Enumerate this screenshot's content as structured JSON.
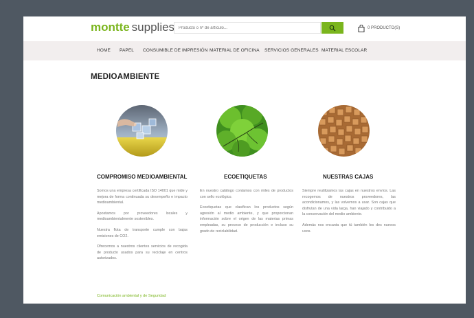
{
  "header": {
    "logo_bold": "montte",
    "logo_light": "supplies",
    "search_placeholder": "Producto o nº de artículo...",
    "cart_label": "0 PRODUCTO(S)"
  },
  "nav": {
    "items": [
      "HOME",
      "PAPEL",
      "CONSUMIBLE DE IMPRESIÓN",
      "MATERIAL DE OFICINA",
      "SERVICIOS GENERALES",
      "MATERIAL ESCOLAR"
    ]
  },
  "main": {
    "title": "MEDIOAMBIENTE",
    "columns": [
      {
        "title": "COMPROMISO MEDIOAMBIENTAL",
        "paragraphs": [
          "Somos una empresa certificada ISO 14001 que mide y mejora de forma continuada su desempeño e impacto medioambiental.",
          "Apostamos por proveedores locales y medioambientalmente sostenibles.",
          "Nuestra flota de transporte cumple con bajas emisiones de CO2.",
          "Ofrecemos a nuestros clientes servicios de recogida de producto usados para su reciclaje en centros autorizados."
        ],
        "link": "Comunicación ambiental y de Seguridad"
      },
      {
        "title": "ECOETIQUETAS",
        "paragraphs": [
          "En nuestro catálogo contamos con miles de productos con sello ecológico.",
          "Ecoetiquetas que clasifican los productos según agresión al medio ambiente, y que proporcionan información sobre el origen de las materias primas empleadas, su proceso de producción e incluso su grado de reciclabilidad."
        ]
      },
      {
        "title": "NUESTRAS CAJAS",
        "paragraphs": [
          "Siempre reutilizamos las cajas en nuestros envíos. Las recogemos de nuestros proveedores, las acondicionamos, y las volvemos a usar. Son cajas que disfrutan de una vida larga, han viajado y contribuido a la conservación del medio ambiente.",
          "Además nos encanta que tú también les des nuevos usos."
        ]
      }
    ]
  },
  "colors": {
    "brand_green": "#7ab51d",
    "frame": "#4f5862",
    "nav_bg": "#f2eeee"
  }
}
